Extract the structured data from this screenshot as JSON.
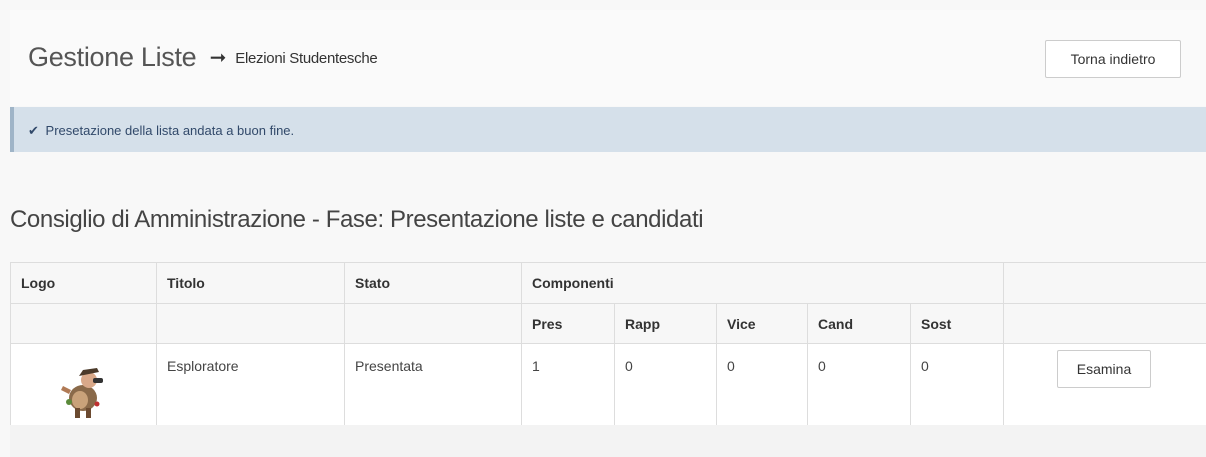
{
  "header": {
    "title": "Gestione Liste",
    "arrow": "➞",
    "subtitle": "Elezioni Studentesche",
    "back_label": "Torna indietro"
  },
  "alert": {
    "icon": "check-icon",
    "message": "Presetazione della lista andata a buon fine."
  },
  "section": {
    "title": "Consiglio di Amministrazione - Fase: Presentazione liste e candidati"
  },
  "table": {
    "headers": {
      "logo": "Logo",
      "titolo": "Titolo",
      "stato": "Stato",
      "componenti": "Componenti",
      "pres": "Pres",
      "rapp": "Rapp",
      "vice": "Vice",
      "cand": "Cand",
      "sost": "Sost"
    },
    "rows": [
      {
        "logo_icon": "explorer-figure-logo",
        "titolo": "Esploratore",
        "stato": "Presentata",
        "pres": "1",
        "rapp": "0",
        "vice": "0",
        "cand": "0",
        "sost": "0",
        "action_label": "Esamina"
      }
    ]
  },
  "colors": {
    "alert_bg": "#d5e0ea",
    "alert_text": "#31496a",
    "page_bg": "#f8f8f8"
  }
}
